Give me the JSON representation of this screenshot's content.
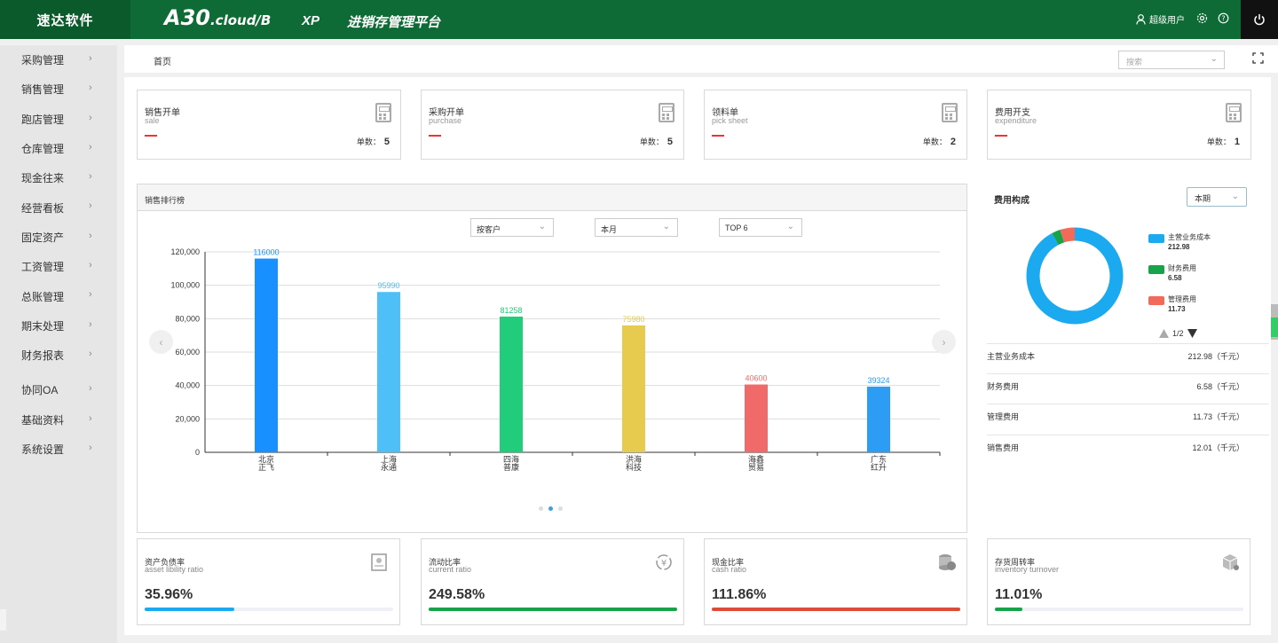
{
  "header": {
    "brand": "速达软件",
    "logo_main": "A30",
    "logo_sub": ".cloud/B",
    "edition": "XP",
    "platform": "进销存管理平台",
    "user": "超级用户"
  },
  "sidebar": {
    "items": [
      {
        "label": "采购管理"
      },
      {
        "label": "销售管理"
      },
      {
        "label": "跑店管理"
      },
      {
        "label": "仓库管理"
      },
      {
        "label": "现金往来"
      },
      {
        "label": "经营看板"
      },
      {
        "label": "固定资产"
      },
      {
        "label": "工资管理"
      },
      {
        "label": "总账管理"
      },
      {
        "label": "期末处理"
      },
      {
        "label": "财务报表"
      },
      {
        "label": "协同OA"
      },
      {
        "label": "基础资料"
      },
      {
        "label": "系统设置"
      }
    ]
  },
  "breadcrumb": {
    "home": "首页"
  },
  "search": {
    "placeholder": "搜索"
  },
  "cards": [
    {
      "title": "销售开单",
      "subtitle": "sale",
      "count_label": "单数：",
      "count": "5"
    },
    {
      "title": "采购开单",
      "subtitle": "purchase",
      "count_label": "单数：",
      "count": "5"
    },
    {
      "title": "领料单",
      "subtitle": "pick sheet",
      "count_label": "单数：",
      "count": "2"
    },
    {
      "title": "费用开支",
      "subtitle": "expenditure",
      "count_label": "单数：",
      "count": "1"
    }
  ],
  "sales_rank": {
    "title": "销售排行榜",
    "filter_customer": "按客户",
    "filter_period": "本月",
    "filter_top": "TOP 6"
  },
  "chart_data": {
    "type": "bar",
    "categories": [
      "北京\n正飞",
      "上海\n永通",
      "四海\n普康",
      "洪海\n科技",
      "海鑫\n贸易",
      "广东\n红升"
    ],
    "values": [
      116000,
      95990,
      81258,
      75980,
      40600,
      39324
    ],
    "colors": [
      "#1890ff",
      "#4ec0f7",
      "#21cc7a",
      "#e6cb4e",
      "#f06a6a",
      "#2d9cf5"
    ],
    "yticks": [
      "120,000",
      "100,000",
      "80,000",
      "60,000",
      "40,000",
      "20,000",
      "0"
    ],
    "ylim": [
      0,
      120000
    ],
    "grid": true
  },
  "fee": {
    "title": "费用构成",
    "period": "本期",
    "pager": "1/2",
    "legend": [
      {
        "name": "主营业务成本",
        "value": "212.98",
        "color": "#1ba9f0"
      },
      {
        "name": "财务费用",
        "value": "6.58",
        "color": "#16a34a"
      },
      {
        "name": "管理费用",
        "value": "11.73",
        "color": "#f16a5a"
      }
    ],
    "rows": [
      {
        "name": "主营业务成本",
        "value": "212.98（千元）"
      },
      {
        "name": "财务费用",
        "value": "6.58（千元）"
      },
      {
        "name": "管理费用",
        "value": "11.73（千元）"
      },
      {
        "name": "销售费用",
        "value": "12.01（千元）"
      }
    ],
    "donut": [
      212.98,
      6.58,
      11.73
    ]
  },
  "ratios": [
    {
      "title": "资产负债率",
      "subtitle": "asset libility ratio",
      "value": "35.96%",
      "fraction": 0.3596,
      "color": "#1ba9f0"
    },
    {
      "title": "流动比率",
      "subtitle": "current ratio",
      "value": "249.58%",
      "fraction": 1.0,
      "color": "#16a34a"
    },
    {
      "title": "现金比率",
      "subtitle": "cash ratio",
      "value": "111.86%",
      "fraction": 1.0,
      "color": "#dd4b39"
    },
    {
      "title": "存货周转率",
      "subtitle": "inventory turnover",
      "value": "11.01%",
      "fraction": 0.1101,
      "color": "#16a34a"
    }
  ]
}
